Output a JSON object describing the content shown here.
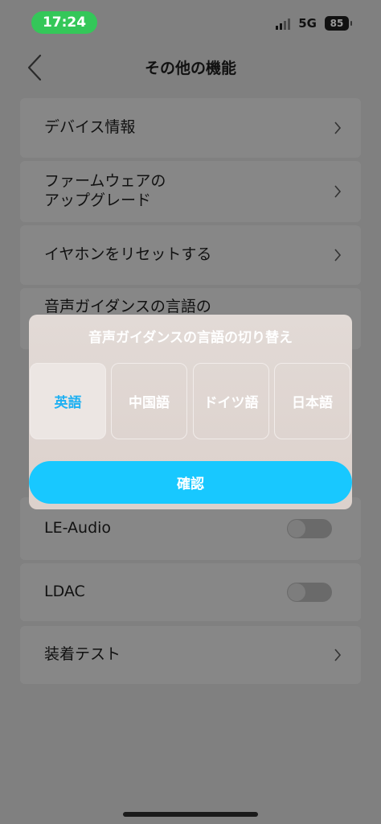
{
  "status_bar": {
    "time": "17:24",
    "network": "5G",
    "battery": "85"
  },
  "header": {
    "title": "その他の機能"
  },
  "menu": {
    "device_info": "デバイス情報",
    "firmware_line1": "ファームウェアの",
    "firmware_line2": "アップグレード",
    "reset": "イヤホンをリセットする",
    "voice_guidance_partial": "音声ガイダンスの言語の",
    "le_audio": "LE-Audio",
    "ldac": "LDAC",
    "wear_test": "装着テスト"
  },
  "toggles": {
    "le_audio_on": false,
    "ldac_on": false
  },
  "dialog": {
    "title": "音声ガイダンスの言語の切り替え",
    "options": [
      "英語",
      "中国語",
      "ドイツ語",
      "日本語"
    ],
    "selected": "英語",
    "confirm_label": "確認"
  },
  "colors": {
    "overlay_background": "#808080",
    "accent": "#18c8ff",
    "selected_text": "#1fb0f2",
    "status_time_bg": "#34c759"
  }
}
